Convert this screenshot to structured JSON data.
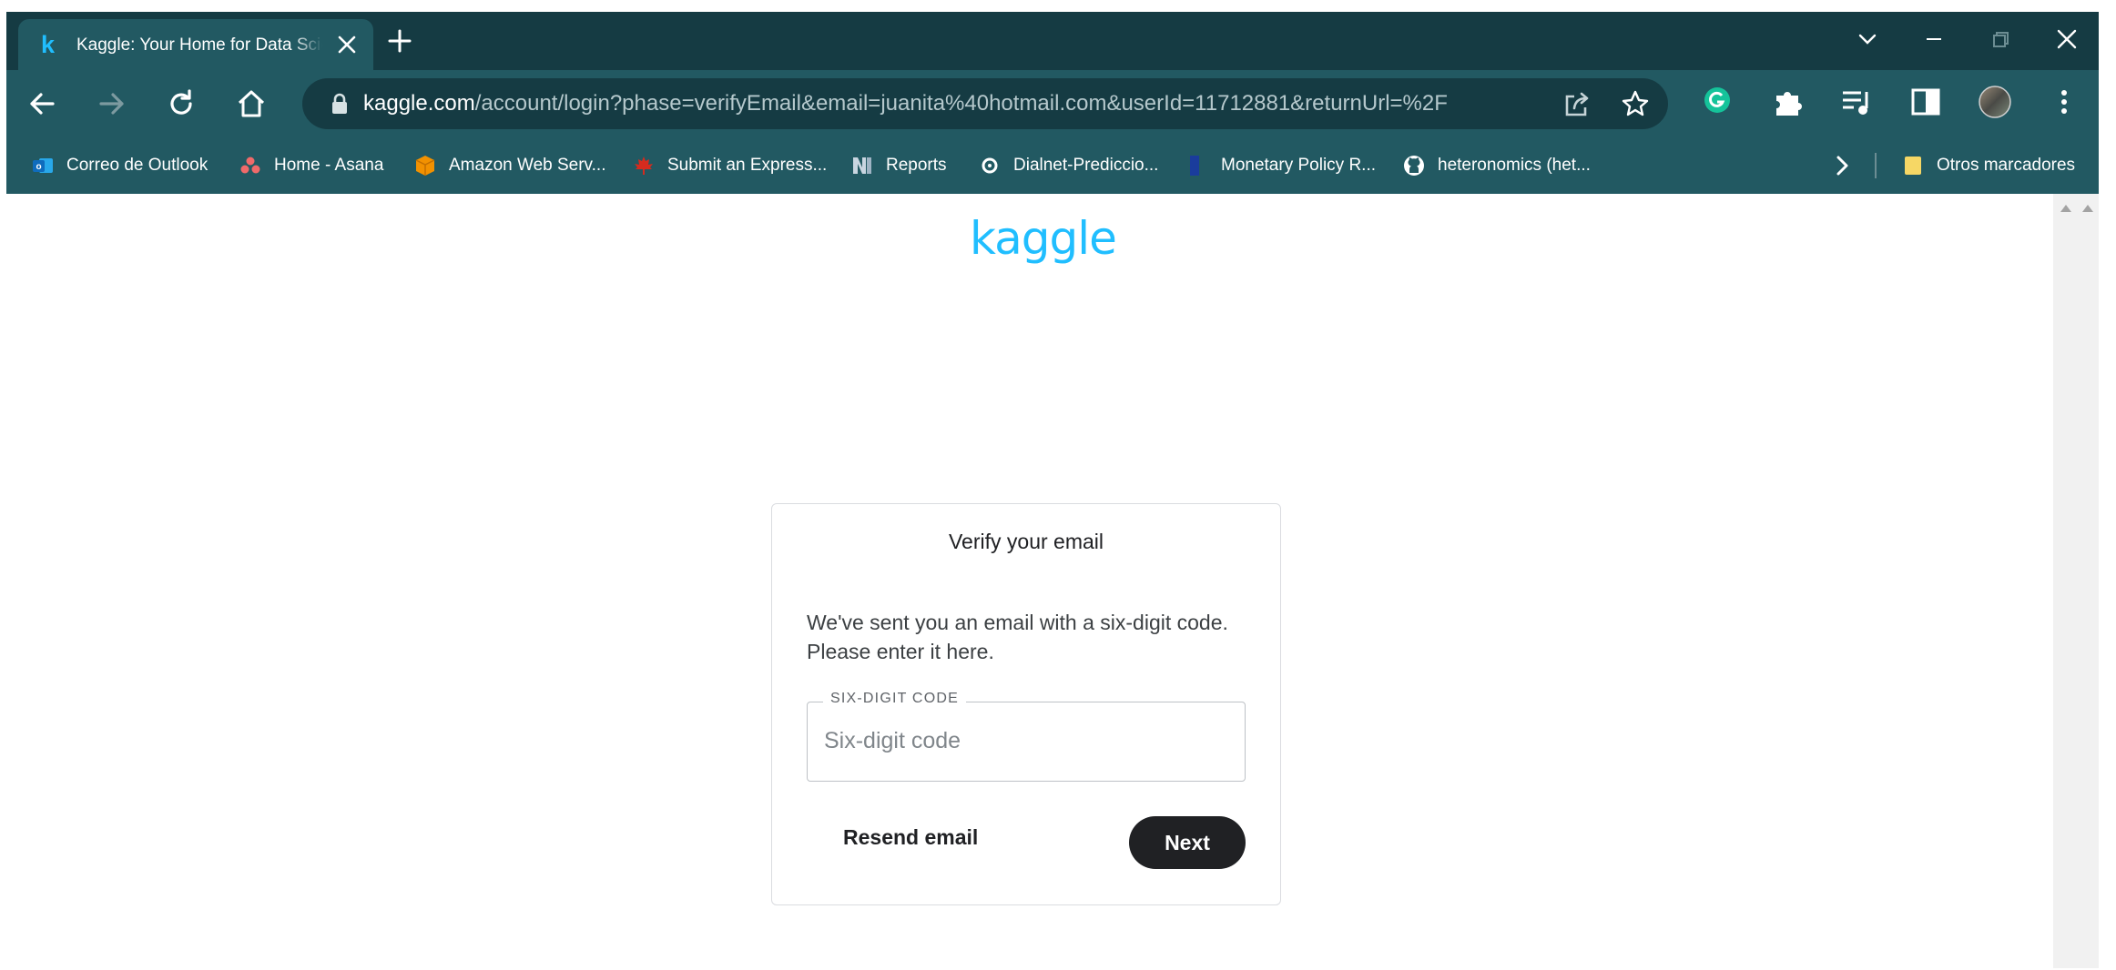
{
  "browser": {
    "tab": {
      "title": "Kaggle: Your Home for Data Science",
      "favicon": "k"
    },
    "new_tab_label": "+",
    "url": {
      "domain": "kaggle.com",
      "path": "/account/login?phase=verifyEmail&email=juanita%40hotmail.com&userId=11712881&returnUrl=%2F"
    },
    "bookmarks": [
      {
        "label": "Correo de Outlook",
        "icon": "outlook-icon",
        "color": "#0f6cbd"
      },
      {
        "label": "Home - Asana",
        "icon": "asana-icon",
        "color": "#f06a6a"
      },
      {
        "label": "Amazon Web Serv...",
        "icon": "aws-icon",
        "color": "#f29100"
      },
      {
        "label": "Submit an Express...",
        "icon": "maple-leaf-icon",
        "color": "#d52b1e"
      },
      {
        "label": "Reports",
        "icon": "reports-icon",
        "color": "#c8d5e0"
      },
      {
        "label": "Dialnet-Prediccio...",
        "icon": "dialnet-icon",
        "color": "#ffffff"
      },
      {
        "label": "Monetary Policy R...",
        "icon": "bookmark-blue-icon",
        "color": "#1a3c9c"
      },
      {
        "label": "heteronomics (het...",
        "icon": "github-icon",
        "color": "#ffffff"
      }
    ],
    "other_bookmarks_label": "Otros marcadores"
  },
  "page": {
    "logo": "kaggle",
    "card": {
      "title": "Verify your email",
      "description_line1": "We've sent you an email with a six-digit code.",
      "description_line2": "Please enter it here.",
      "field_label": "SIX-DIGIT CODE",
      "field_placeholder": "Six-digit code",
      "field_value": "",
      "resend_label": "Resend email",
      "next_label": "Next"
    }
  },
  "colors": {
    "tabstrip": "#153b43",
    "toolbar": "#225962",
    "kaggle_blue": "#20beff",
    "button_dark": "#202124"
  }
}
